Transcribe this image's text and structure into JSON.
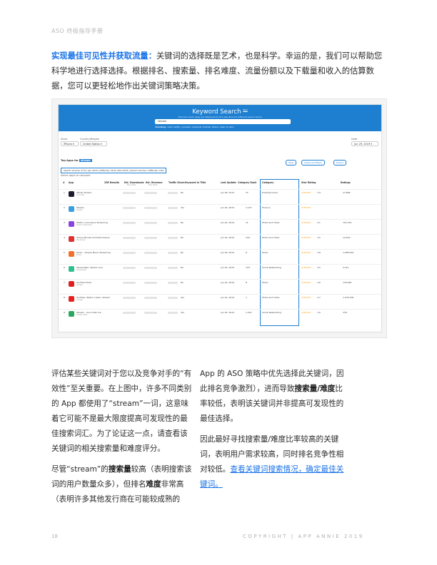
{
  "header": {
    "title": "ASO 终极指导手册"
  },
  "intro": {
    "highlight": "实现最佳可见性并获取流量：",
    "text": "关键词的选择既是艺术，也是科学。幸运的是，我们可以帮助您科学地进行选择选择。根据排名、搜索量、排名难度、流量份额以及下载量和收入的估算数据，您可以更轻松地作出关键词策略决策。"
  },
  "screenshot": {
    "title": "Keyword Search",
    "title_badge": "New",
    "subtitle": "Discover which apps are displayed by the app store for different search terms",
    "search_value": "stream",
    "trending_label": "Trending:",
    "trending_items": "clash netflix, youtube, snapchat, fortnite, tiktok, clash of clans",
    "store_label": "Store",
    "store_value": "iPhone",
    "country_label": "Country/Region",
    "country_value": "United States",
    "date_label": "Date",
    "date_value": "Jun 29, 2019",
    "top_apps_label": "Top Apps for",
    "top_apps_keyword": "stream",
    "buttons": [
      "Save",
      "Advanced Filters",
      "Export"
    ],
    "stats": "Search Volume: 47.8 | Apr 2019 | Difficulty: 56.8 | Max 2019 | Search Volume / Difficulty: 0.84",
    "select_label": "Select apps to compare",
    "columns": [
      "#",
      "App",
      "256 Results",
      "Est. Downloads",
      "Est. Revenue",
      "Traffic Share",
      "Keyword in Title",
      "Last Update",
      "Category Rank",
      "Category",
      "Star Rating",
      "Ratings"
    ],
    "col_subs": {
      "downloads": "May 2019",
      "revenue": "May 2019"
    },
    "rows": [
      {
        "rank": "1",
        "name": "Xfinity Stream",
        "pub": "Comcast",
        "title": "No",
        "update": "Jun 28, 2019",
        "crank": "37",
        "category": "Entertainment",
        "score": "3.9",
        "ratings": "27,866",
        "color": "#1c1c2e"
      },
      {
        "rank": "2",
        "name": "Stream",
        "pub": "Stream",
        "title": "Yes",
        "update": "Jun 24, 2019",
        "crank": "1,147",
        "category": "Finance",
        "score": "",
        "ratings": "",
        "color": "#3aa0e0"
      },
      {
        "rank": "3",
        "name": "Twitch: Live Game Streaming",
        "pub": "Twitch Interactive",
        "title": "No",
        "update": "Jun 24, 2019",
        "crank": "11",
        "category": "Photo and Video",
        "score": "4.1",
        "ratings": "752,140",
        "color": "#8a43e0"
      },
      {
        "rank": "4",
        "name": "Online Movies Unlimited Series",
        "pub": "Developer",
        "title": "No",
        "update": "Jun 24, 2019",
        "crank": "244",
        "category": "Photo and Video",
        "score": "4.5",
        "ratings": "14,544",
        "color": "#e03030"
      },
      {
        "rank": "5",
        "name": "Music - Simple Music Streaming",
        "pub": "Music",
        "title": "No",
        "update": "Jun 26, 2019",
        "crank": "8",
        "category": "Music",
        "score": "4.8",
        "ratings": "1,658,529",
        "color": "#f07028"
      },
      {
        "rank": "6",
        "name": "Streamlabs: Stream Live",
        "pub": "Streamlabs",
        "title": "No",
        "update": "Jun 25, 2019",
        "crank": "118",
        "category": "Social Networking",
        "score": "4.5",
        "ratings": "4,311",
        "color": "#30c090"
      },
      {
        "rank": "7",
        "name": "YouTube Music",
        "pub": "Google",
        "title": "No",
        "update": "Jun 24, 2019",
        "crank": "8",
        "category": "Music",
        "score": "4.6",
        "ratings": "144,965",
        "color": "#e02020"
      },
      {
        "rank": "8",
        "name": "YouTube: Watch, Listen, Stream",
        "pub": "Google",
        "title": "Yes",
        "update": "Jun 24, 2019",
        "crank": "1",
        "category": "Photo and Video",
        "score": "4.7",
        "ratings": "1,578,798",
        "color": "#e82020"
      },
      {
        "rank": "9",
        "name": "Stream - Live Video Ca...",
        "pub": "Stream Now",
        "title": "Yes",
        "update": "Jun 24, 2019",
        "crank": "1,031",
        "category": "Social Networking",
        "score": "3.6",
        "ratings": "378",
        "color": "#2aa860"
      }
    ]
  },
  "col1": {
    "p1": "评估某些关键词对于您以及竞争对手的“有效性”至关重要。在上图中，许多不同类别的 App 都使用了“stream”一词，这意味着它可能不是最大限度提高可发现性的最佳搜索词汇。为了论证这一点，请查看该关键词的相关搜索量和难度评分。",
    "p2_a": "尽管“stream”的",
    "p2_b": "搜索量",
    "p2_c": "较高（表明搜索该词的用户数量众多），但排名",
    "p2_d": "难度",
    "p2_e": "非常高（表明许多其他发行商在可能较成熟的"
  },
  "col2": {
    "p1_a": "App 的 ASO 策略中优先选择此关键词，因此排名竞争激烈），进而导致",
    "p1_b": "搜索量/难度",
    "p1_c": "比率较低，表明该关键词并非提高可发现性的最佳选择。",
    "p2_a": "因此最好寻找搜索量/难度比率较高的关键词，表明用户需求较高，同时排名竞争性相对较低。",
    "p2_link": "查看关键词搜索情况，确定最佳关键词。"
  },
  "footer": {
    "page": "18",
    "copyright": "COPYRIGHT | APP ANNIE 2019"
  }
}
